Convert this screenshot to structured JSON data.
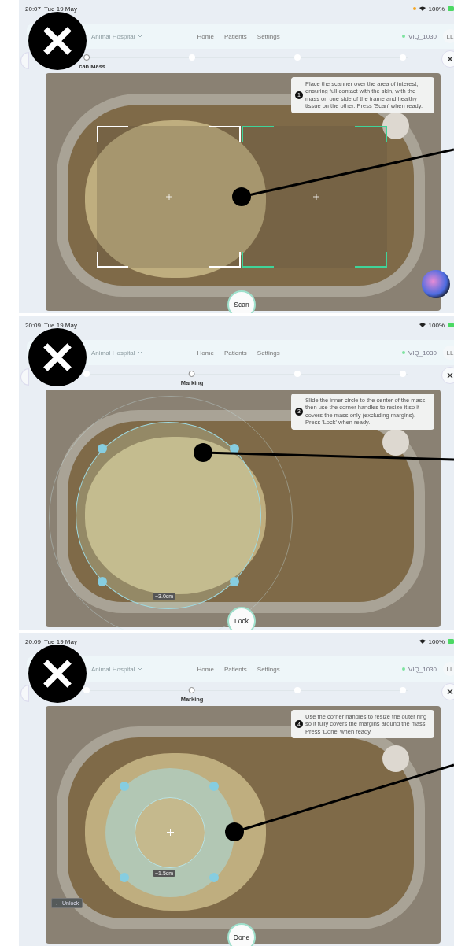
{
  "screens": [
    {
      "status_bar": {
        "time": "20:07",
        "date": "Tue 19 May",
        "battery": "100%",
        "privacy_dot": true
      },
      "nav": {
        "hospital": "Animal Hospital",
        "links": [
          "Home",
          "Patients",
          "Settings"
        ],
        "device": "VIQ_1030",
        "user": "LL"
      },
      "steps": [
        {
          "label": "can Mass",
          "selected": true
        },
        {
          "selected": false
        },
        {
          "selected": false
        },
        {
          "selected": false
        }
      ],
      "instruction": {
        "number": "1",
        "text": "Place the scanner over the area of interest, ensuring full contact with the skin, with the mass on one side of the frame and healthy tissue on the other. Press 'Scan' when ready."
      },
      "overlay": {
        "kind": "frame"
      },
      "action": "Scan",
      "assistant_orb": true
    },
    {
      "status_bar": {
        "time": "20:09",
        "date": "Tue 19 May",
        "battery": "100%",
        "privacy_dot": false
      },
      "nav": {
        "hospital": "Animal Hospital",
        "links": [
          "Home",
          "Patients",
          "Settings"
        ],
        "device": "VIQ_1030",
        "user": "LL"
      },
      "steps": [
        {
          "selected": false
        },
        {
          "label": "Marking",
          "selected": true
        },
        {
          "selected": false
        },
        {
          "selected": false
        }
      ],
      "instruction": {
        "number": "3",
        "text": "Slide the inner circle to the center of the mass, then use the corner handles to resize it so it covers the mass only (excluding margins). Press 'Lock' when ready."
      },
      "overlay": {
        "kind": "circle",
        "size_label": "~3.0cm"
      },
      "action": "Lock",
      "assistant_orb": false
    },
    {
      "status_bar": {
        "time": "20:09",
        "date": "Tue 19 May",
        "battery": "100%",
        "privacy_dot": false
      },
      "nav": {
        "hospital": "Animal Hospital",
        "links": [
          "Home",
          "Patients",
          "Settings"
        ],
        "device": "VIQ_1030",
        "user": "LL"
      },
      "steps": [
        {
          "selected": false
        },
        {
          "label": "Marking",
          "selected": true
        },
        {
          "selected": false
        },
        {
          "selected": false
        }
      ],
      "instruction": {
        "number": "4",
        "text": "Use the corner handles to resize the outer ring so it fully covers the margins around the mass. Press 'Done' when ready."
      },
      "overlay": {
        "kind": "ring",
        "size_label": "~1.5cm"
      },
      "unlock": "← Unlock",
      "action": "Done",
      "assistant_orb": false
    }
  ]
}
